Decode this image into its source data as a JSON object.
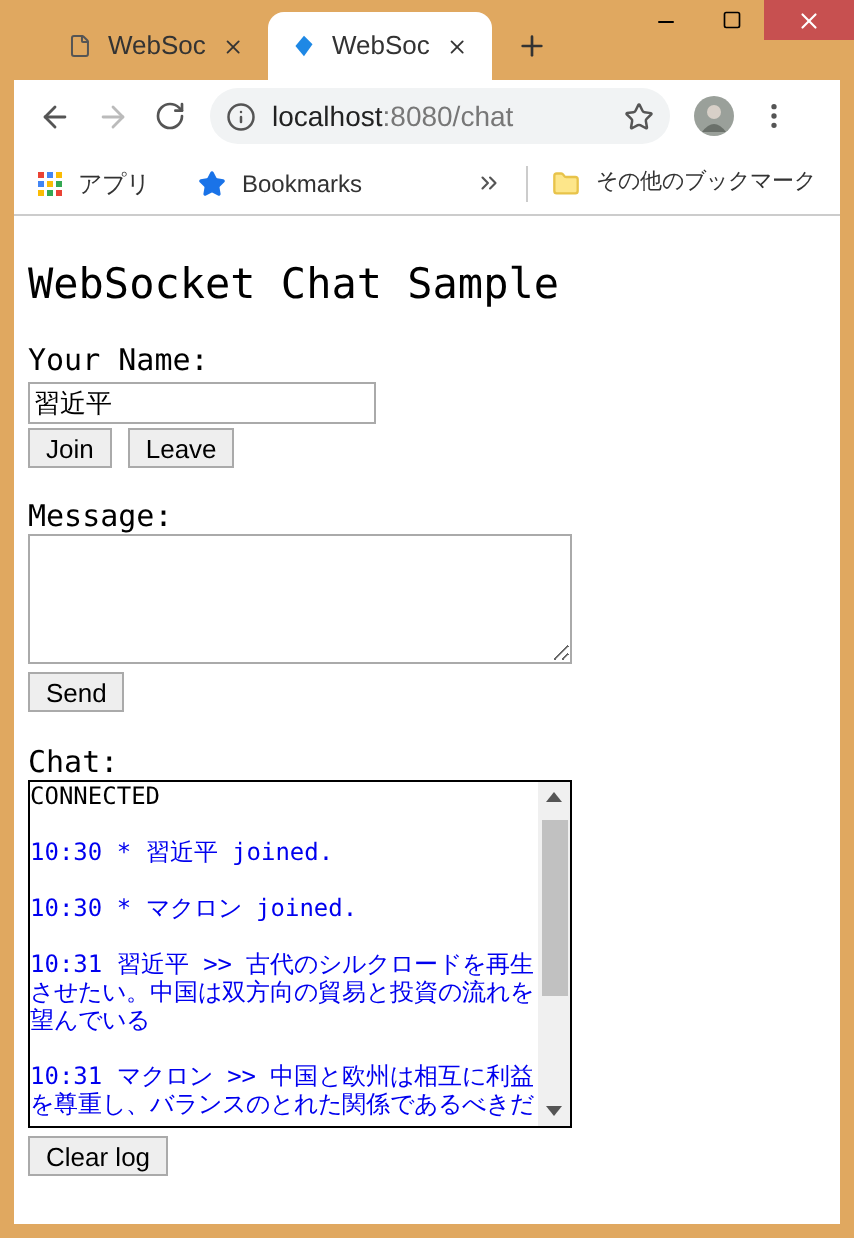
{
  "tabs": [
    {
      "title": "WebSoc",
      "selected": false,
      "kind": "page"
    },
    {
      "title": "WebSoc",
      "selected": true,
      "kind": "app"
    }
  ],
  "address_bar": {
    "host": "localhost",
    "path": ":8080/chat"
  },
  "bookmarks_bar": {
    "apps": "アプリ",
    "bookmarks": "Bookmarks",
    "other": "その他のブックマーク"
  },
  "page": {
    "heading": "WebSocket Chat Sample",
    "name_label": "Your Name:",
    "name_value": "習近平",
    "join": "Join",
    "leave": "Leave",
    "message_label": "Message:",
    "send": "Send",
    "chat_label": "Chat:",
    "clear": "Clear log",
    "log": [
      {
        "kind": "status",
        "text": "CONNECTED"
      },
      {
        "kind": "message",
        "text": "10:30 * 習近平 joined."
      },
      {
        "kind": "message",
        "text": "10:30 * マクロン joined."
      },
      {
        "kind": "message",
        "text": "10:31 習近平 >> 古代のシルクロードを再生させたい。中国は双方向の貿易と投資の流れを望んでいる"
      },
      {
        "kind": "message",
        "text": "10:31 マクロン >> 中国と欧州は相互に利益を尊重し、バランスのとれた関係であるべきだ"
      }
    ]
  }
}
